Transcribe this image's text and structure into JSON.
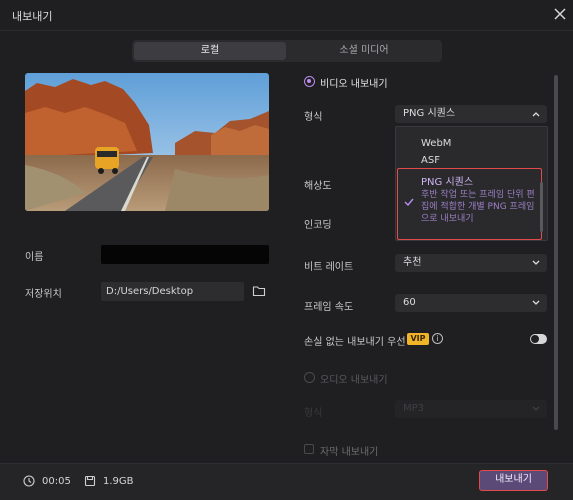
{
  "window": {
    "title": "내보내기"
  },
  "tabs": [
    {
      "label": "로컬",
      "active": true
    },
    {
      "label": "소셜 미디어",
      "active": false
    }
  ],
  "left": {
    "name_label": "이름",
    "name_value": "",
    "path_label": "저장위치",
    "path_value": "D:/Users/Desktop"
  },
  "right": {
    "video_export_label": "비디오 내보내기",
    "format_label": "형식",
    "format_value": "PNG 시퀀스",
    "format_options": [
      "WebM",
      "ASF",
      "PNG 시퀀스"
    ],
    "format_selected_desc": "후반 작업 또는 프레임 단위 편집에 적합한 개별 PNG 프레임으로 내보내기",
    "resolution_label": "해상도",
    "encoding_label": "인코딩",
    "bitrate_label": "비트 레이트",
    "bitrate_value": "추천",
    "framerate_label": "프레임 속도",
    "framerate_value": "60",
    "lossless_label": "손실 없는 내보내기 우선",
    "vip_badge": "VIP",
    "audio_export_label": "오디오 내보내기",
    "audio_format_label": "형식",
    "audio_format_value": "MP3",
    "subtitle_export_label": "자막 내보내기"
  },
  "footer": {
    "duration": "00:05",
    "size": "1.9GB",
    "export_button": "내보내기"
  },
  "colors": {
    "accent": "#b98cf0",
    "highlight": "#e24b4b",
    "vip": "#f0b429"
  }
}
